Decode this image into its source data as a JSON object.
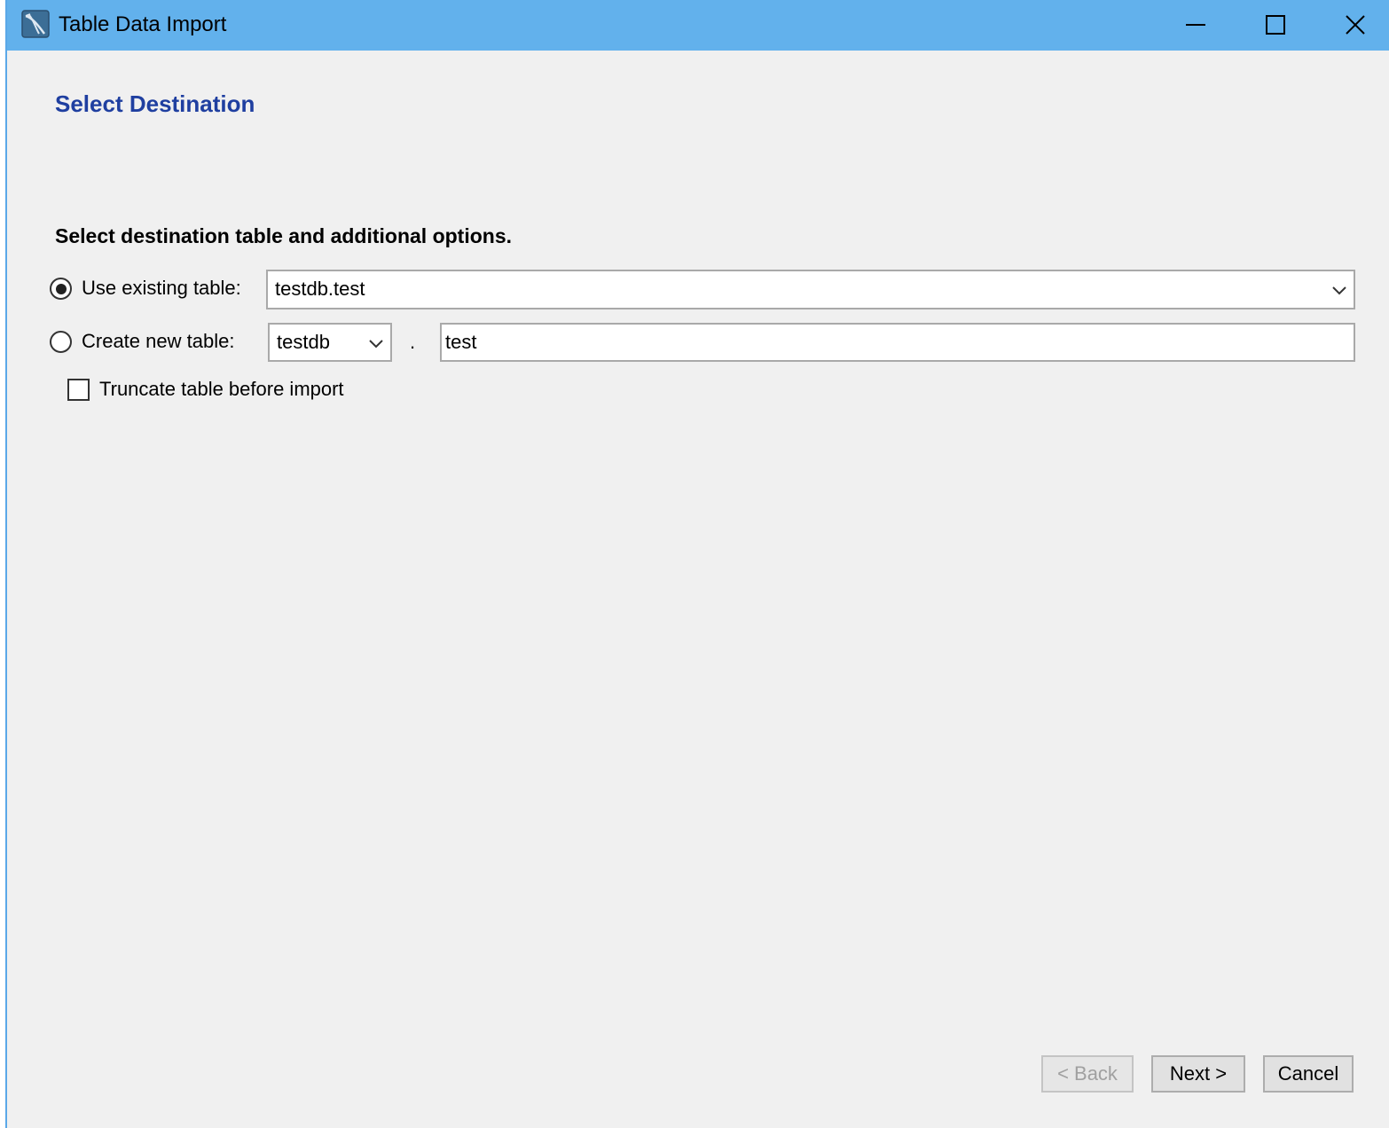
{
  "window": {
    "title": "Table Data Import",
    "icon": "mysql-dolphin-icon"
  },
  "page": {
    "heading": "Select Destination",
    "instruction": "Select destination table and additional options."
  },
  "options": {
    "use_existing_label": "Use existing table:",
    "use_existing_selected": true,
    "existing_table_value": "testdb.test",
    "create_new_label": "Create new table:",
    "create_new_selected": false,
    "schema_value": "testdb",
    "separator": ".",
    "new_table_name": "test",
    "truncate_label": "Truncate table before import",
    "truncate_checked": false
  },
  "buttons": {
    "back": "< Back",
    "next": "Next >",
    "cancel": "Cancel"
  },
  "colors": {
    "titlebar": "#62b1ec",
    "heading": "#1f3fa0",
    "background": "#f0f0f0"
  }
}
